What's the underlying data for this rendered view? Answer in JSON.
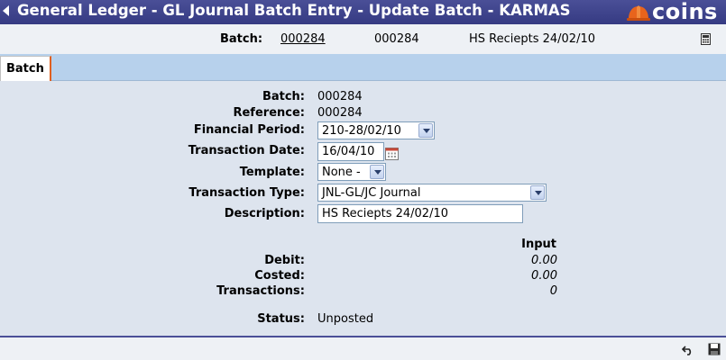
{
  "header": {
    "title": "General Ledger - GL Journal Batch Entry - Update Batch - KARMAS",
    "logo_text": "coins"
  },
  "batch_bar": {
    "label": "Batch:",
    "batch_link": "000284",
    "reference": "000284",
    "description": "HS Reciepts 24/02/10"
  },
  "tabs": [
    {
      "label": "Batch",
      "selected": true
    }
  ],
  "form": {
    "batch_label": "Batch:",
    "batch_value": "000284",
    "reference_label": "Reference:",
    "reference_value": "000284",
    "financial_period_label": "Financial Period:",
    "financial_period_value": "210-28/02/10",
    "transaction_date_label": "Transaction Date:",
    "transaction_date_value": "16/04/10",
    "template_label": "Template:",
    "template_value": "None -",
    "transaction_type_label": "Transaction Type:",
    "transaction_type_value": "JNL-GL/JC Journal",
    "description_label": "Description:",
    "description_value": "HS Reciepts 24/02/10"
  },
  "totals": {
    "column_header": "Input",
    "debit_label": "Debit:",
    "debit_value": "0.00",
    "costed_label": "Costed:",
    "costed_value": "0.00",
    "transactions_label": "Transactions:",
    "transactions_value": "0"
  },
  "status": {
    "label": "Status:",
    "value": "Unposted"
  },
  "colors": {
    "title_bar": "#3b4089",
    "tab_bar": "#b7d1ec",
    "form_bg": "#dde4ee",
    "logo_helmet": "#e8641c"
  },
  "icons": {
    "back": "back-arrow-icon",
    "calculator": "calculator-icon",
    "calendar": "calendar-icon",
    "undo": "undo-icon",
    "save": "save-icon"
  }
}
